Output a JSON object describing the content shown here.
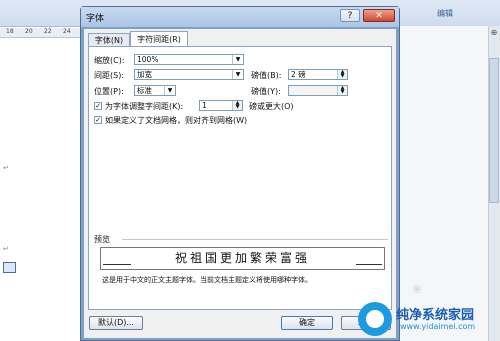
{
  "background": {
    "ribbon_group": "编辑",
    "ruler_ticks": [
      "18",
      "20",
      "22",
      "24"
    ],
    "para_marks": [
      "↵",
      "↵"
    ]
  },
  "dialog": {
    "title": "字体",
    "help": "?",
    "close": "✕",
    "tabs": [
      {
        "label": "字体(N)",
        "active": false
      },
      {
        "label": "字符间距(R)",
        "active": true
      }
    ],
    "scale": {
      "label": "缩放(C):",
      "value": "100%"
    },
    "spacing": {
      "label": "间距(S):",
      "value": "加宽",
      "by_label": "磅值(B):",
      "by_value": "2 磅"
    },
    "position": {
      "label": "位置(P):",
      "value": "标准",
      "by_label": "磅值(Y):",
      "by_value": ""
    },
    "kerning": {
      "label": "为字体调整字间距(K):",
      "checked": true,
      "value": "1",
      "suffix": "磅或更大(O)"
    },
    "grid": {
      "label": "如果定义了文档网格，则对齐到网格(W)",
      "checked": true
    },
    "preview": {
      "label": "预览",
      "sample": "祝祖国更加繁荣富强",
      "note": "这是用于中文的正文主题字体。当前文档主题定义将使用哪种字体。"
    },
    "buttons": {
      "default": "默认(D)...",
      "ok": "确定",
      "cancel": "取消"
    }
  },
  "watermark": {
    "title": "纯净系统家园",
    "url": "www.yidaimei.com"
  },
  "colors": {
    "accent": "#1a5fb4",
    "dialog_frame": "#7fa1c9",
    "close_button": "#c94a33"
  }
}
